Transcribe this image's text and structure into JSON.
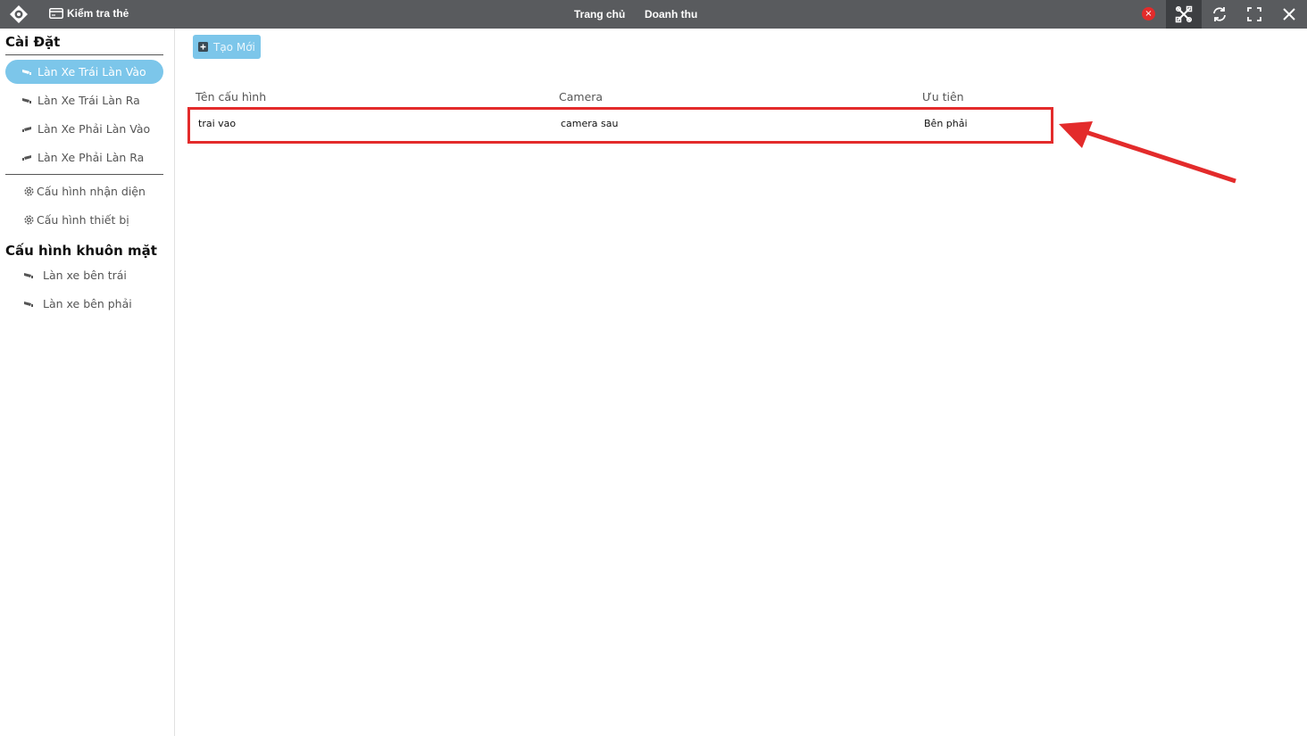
{
  "topbar": {
    "check_card_label": "Kiểm tra thẻ",
    "nav": {
      "home": "Trang chủ",
      "revenue": "Doanh thu"
    },
    "status_dot": "×",
    "colors": {
      "bar": "#595b5e",
      "status": "#e32b2b"
    }
  },
  "sidebar": {
    "settings_title": "Cài Đặt",
    "lane_items": [
      {
        "label": "Làn Xe Trái Làn Vào",
        "icon": "camera-icon",
        "active": true
      },
      {
        "label": "Làn Xe Trái Làn Ra",
        "icon": "camera-icon",
        "active": false
      },
      {
        "label": "Làn Xe Phải Làn Vào",
        "icon": "camera-icon",
        "active": false
      },
      {
        "label": "Làn Xe Phải Làn Ra",
        "icon": "camera-icon",
        "active": false
      }
    ],
    "config_items": [
      {
        "label": "Cấu hình nhận diện",
        "icon": "gear-icon"
      },
      {
        "label": "Cấu hình thiết bị",
        "icon": "gear-icon"
      }
    ],
    "face_title": "Cấu hình khuôn mặt",
    "face_items": [
      {
        "label": "Làn xe bên trái",
        "icon": "camera-icon"
      },
      {
        "label": "Làn xe bên phải",
        "icon": "camera-icon"
      }
    ],
    "accent": "#7cc6ea"
  },
  "main": {
    "create_button": "Tạo Mới",
    "table": {
      "headers": [
        "Tên cấu hình",
        "Camera",
        "Ưu tiên"
      ],
      "rows": [
        [
          "trai vao",
          "camera sau",
          "Bên phải"
        ]
      ]
    }
  }
}
